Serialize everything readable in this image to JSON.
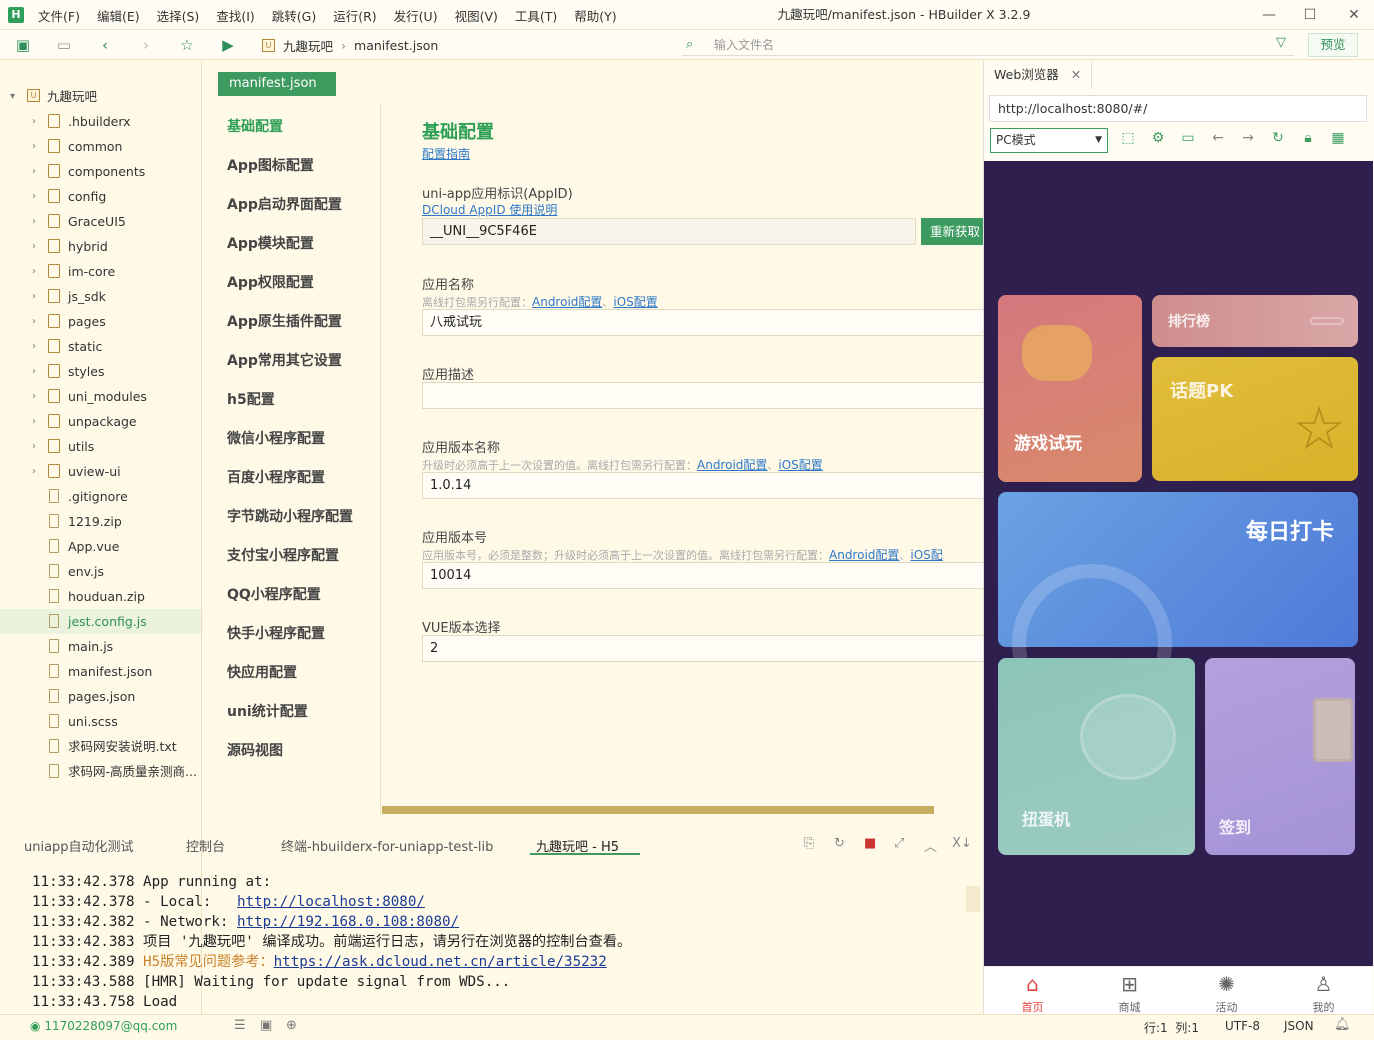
{
  "window": {
    "title": "九趣玩吧/manifest.json - HBuilder X 3.2.9",
    "logo": "H",
    "menu": [
      "文件(F)",
      "编辑(E)",
      "选择(S)",
      "查找(I)",
      "跳转(G)",
      "运行(R)",
      "发行(U)",
      "视图(V)",
      "工具(T)",
      "帮助(Y)"
    ]
  },
  "toolbar": {
    "breadcrumb_root": "九趣玩吧",
    "breadcrumb_file": "manifest.json",
    "file_search_placeholder": "输入文件名",
    "preview_label": "预览"
  },
  "sidebar": {
    "project": "九趣玩吧",
    "items": [
      {
        "label": ".hbuilderx",
        "type": "folder"
      },
      {
        "label": "common",
        "type": "folder"
      },
      {
        "label": "components",
        "type": "folder"
      },
      {
        "label": "config",
        "type": "folder"
      },
      {
        "label": "GraceUI5",
        "type": "folder"
      },
      {
        "label": "hybrid",
        "type": "folder"
      },
      {
        "label": "im-core",
        "type": "folder"
      },
      {
        "label": "js_sdk",
        "type": "folder"
      },
      {
        "label": "pages",
        "type": "folder"
      },
      {
        "label": "static",
        "type": "folder"
      },
      {
        "label": "styles",
        "type": "folder"
      },
      {
        "label": "uni_modules",
        "type": "folder"
      },
      {
        "label": "unpackage",
        "type": "folder"
      },
      {
        "label": "utils",
        "type": "folder"
      },
      {
        "label": "uview-ui",
        "type": "folder"
      },
      {
        "label": ".gitignore",
        "type": "file"
      },
      {
        "label": "1219.zip",
        "type": "file"
      },
      {
        "label": "App.vue",
        "type": "file"
      },
      {
        "label": "env.js",
        "type": "file"
      },
      {
        "label": "houduan.zip",
        "type": "file"
      },
      {
        "label": "jest.config.js",
        "type": "file",
        "selected": true
      },
      {
        "label": "main.js",
        "type": "file"
      },
      {
        "label": "manifest.json",
        "type": "file"
      },
      {
        "label": "pages.json",
        "type": "file"
      },
      {
        "label": "uni.scss",
        "type": "file"
      },
      {
        "label": "求码网安装说明.txt",
        "type": "file"
      },
      {
        "label": "求码网-高质量亲测商...",
        "type": "file"
      }
    ]
  },
  "editor": {
    "tab_label": "manifest.json",
    "nav": [
      "基础配置",
      "App图标配置",
      "App启动界面配置",
      "App模块配置",
      "App权限配置",
      "App原生插件配置",
      "App常用其它设置",
      "h5配置",
      "微信小程序配置",
      "百度小程序配置",
      "字节跳动小程序配置",
      "支付宝小程序配置",
      "QQ小程序配置",
      "快手小程序配置",
      "快应用配置",
      "uni统计配置",
      "源码视图"
    ],
    "section_title": "基础配置",
    "section_link": "配置指南",
    "appid": {
      "label": "uni-app应用标识(AppID)",
      "link": "DCloud AppID 使用说明",
      "value": "__UNI__9C5F46E",
      "button": "重新获取"
    },
    "app_name": {
      "label": "应用名称",
      "hint": "离线打包需另行配置：",
      "link_android": "Android配置",
      "sep": "、",
      "link_ios": "iOS配置",
      "value": "八戒试玩"
    },
    "app_desc": {
      "label": "应用描述",
      "value": ""
    },
    "version_name": {
      "label": "应用版本名称",
      "hint": "升级时必须高于上一次设置的值。离线打包需另行配置：",
      "link_android": "Android配置",
      "sep": "、",
      "link_ios": "iOS配置",
      "value": "1.0.14"
    },
    "version_code": {
      "label": "应用版本号",
      "hint": "应用版本号，必须是整数；升级时必须高于上一次设置的值。离线打包需另行配置：",
      "link_android": "Android配置",
      "sep": "、",
      "link_ios": "iOS配",
      "value": "10014"
    },
    "vue_version": {
      "label": "VUE版本选择",
      "value": "2"
    }
  },
  "console": {
    "tabs": [
      "uniapp自动化测试",
      "控制台",
      "终端-hbuilderx-for-uniapp-test-lib",
      "九趣玩吧 - H5"
    ],
    "lines": [
      {
        "time": "11:33:42.378",
        "text": "App running at:"
      },
      {
        "time": "11:33:42.378",
        "text": "- Local:   ",
        "url": "http://localhost:8080/"
      },
      {
        "time": "11:33:42.382",
        "text": "- Network: ",
        "url": "http://192.168.0.108:8080/"
      },
      {
        "time": "11:33:42.383",
        "text": "项目 '九趣玩吧' 编译成功。前端运行日志，请另行在浏览器的控制台查看。"
      },
      {
        "time": "11:33:42.389",
        "orange": "H5版常见问题参考：",
        "url": "https://ask.dcloud.net.cn/article/35232"
      },
      {
        "time": "11:33:43.588",
        "text": "[HMR] Waiting for update signal from WDS..."
      },
      {
        "time": "11:33:43.758",
        "text": "Load"
      }
    ]
  },
  "status": {
    "user": "1170228097@qq.com",
    "position": "行:1  列:1",
    "encoding": "UTF-8",
    "language": "JSON"
  },
  "browser": {
    "tab_label": "Web浏览器",
    "url": "http://localhost:8080/#/",
    "mode": "PC模式",
    "cards": {
      "game": "游戏试玩",
      "rank": "排行榜",
      "pk": "话题PK",
      "checkin": "每日打卡",
      "gacha": "扭蛋机",
      "sign": "签到"
    },
    "tabbar": [
      "首页",
      "商城",
      "活动",
      "我的"
    ]
  },
  "colors": {
    "accent": "#3d9b5f",
    "bg": "#fffae8",
    "device_bg": "#2e1f4f"
  }
}
